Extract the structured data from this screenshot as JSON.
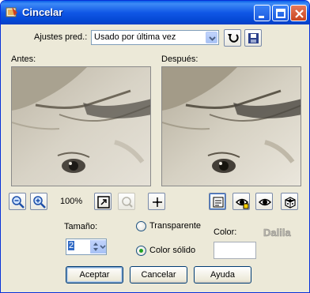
{
  "window": {
    "title": "Cincelar"
  },
  "presets": {
    "label": "Ajustes pred.:",
    "value": "Usado por última vez"
  },
  "before_label": "Antes:",
  "after_label": "Después:",
  "zoom": {
    "value": "100%"
  },
  "size": {
    "label": "Tamaño:",
    "value": "2"
  },
  "fill": {
    "transparent_label": "Transparente",
    "solid_label": "Color sólido",
    "selected": "solid"
  },
  "color": {
    "label": "Color:",
    "value": "#ffffff"
  },
  "watermark": "Dalila",
  "buttons": {
    "ok": "Aceptar",
    "cancel": "Cancelar",
    "help": "Ayuda"
  },
  "colors": {
    "title_bar": "#0a5fe8",
    "dialog_bg": "#ece9d8",
    "selection": "#316ac5"
  },
  "icons": [
    "app-icon",
    "minimize-icon",
    "maximize-icon",
    "close-icon",
    "reset-preset-icon",
    "save-preset-icon",
    "zoom-out-icon",
    "zoom-in-icon",
    "fit-icon",
    "pan-disabled-icon",
    "crosshair-icon",
    "proof-icon",
    "auto-proof-icon",
    "preview-toggle-icon",
    "randomize-icon",
    "chevron-down-icon"
  ]
}
